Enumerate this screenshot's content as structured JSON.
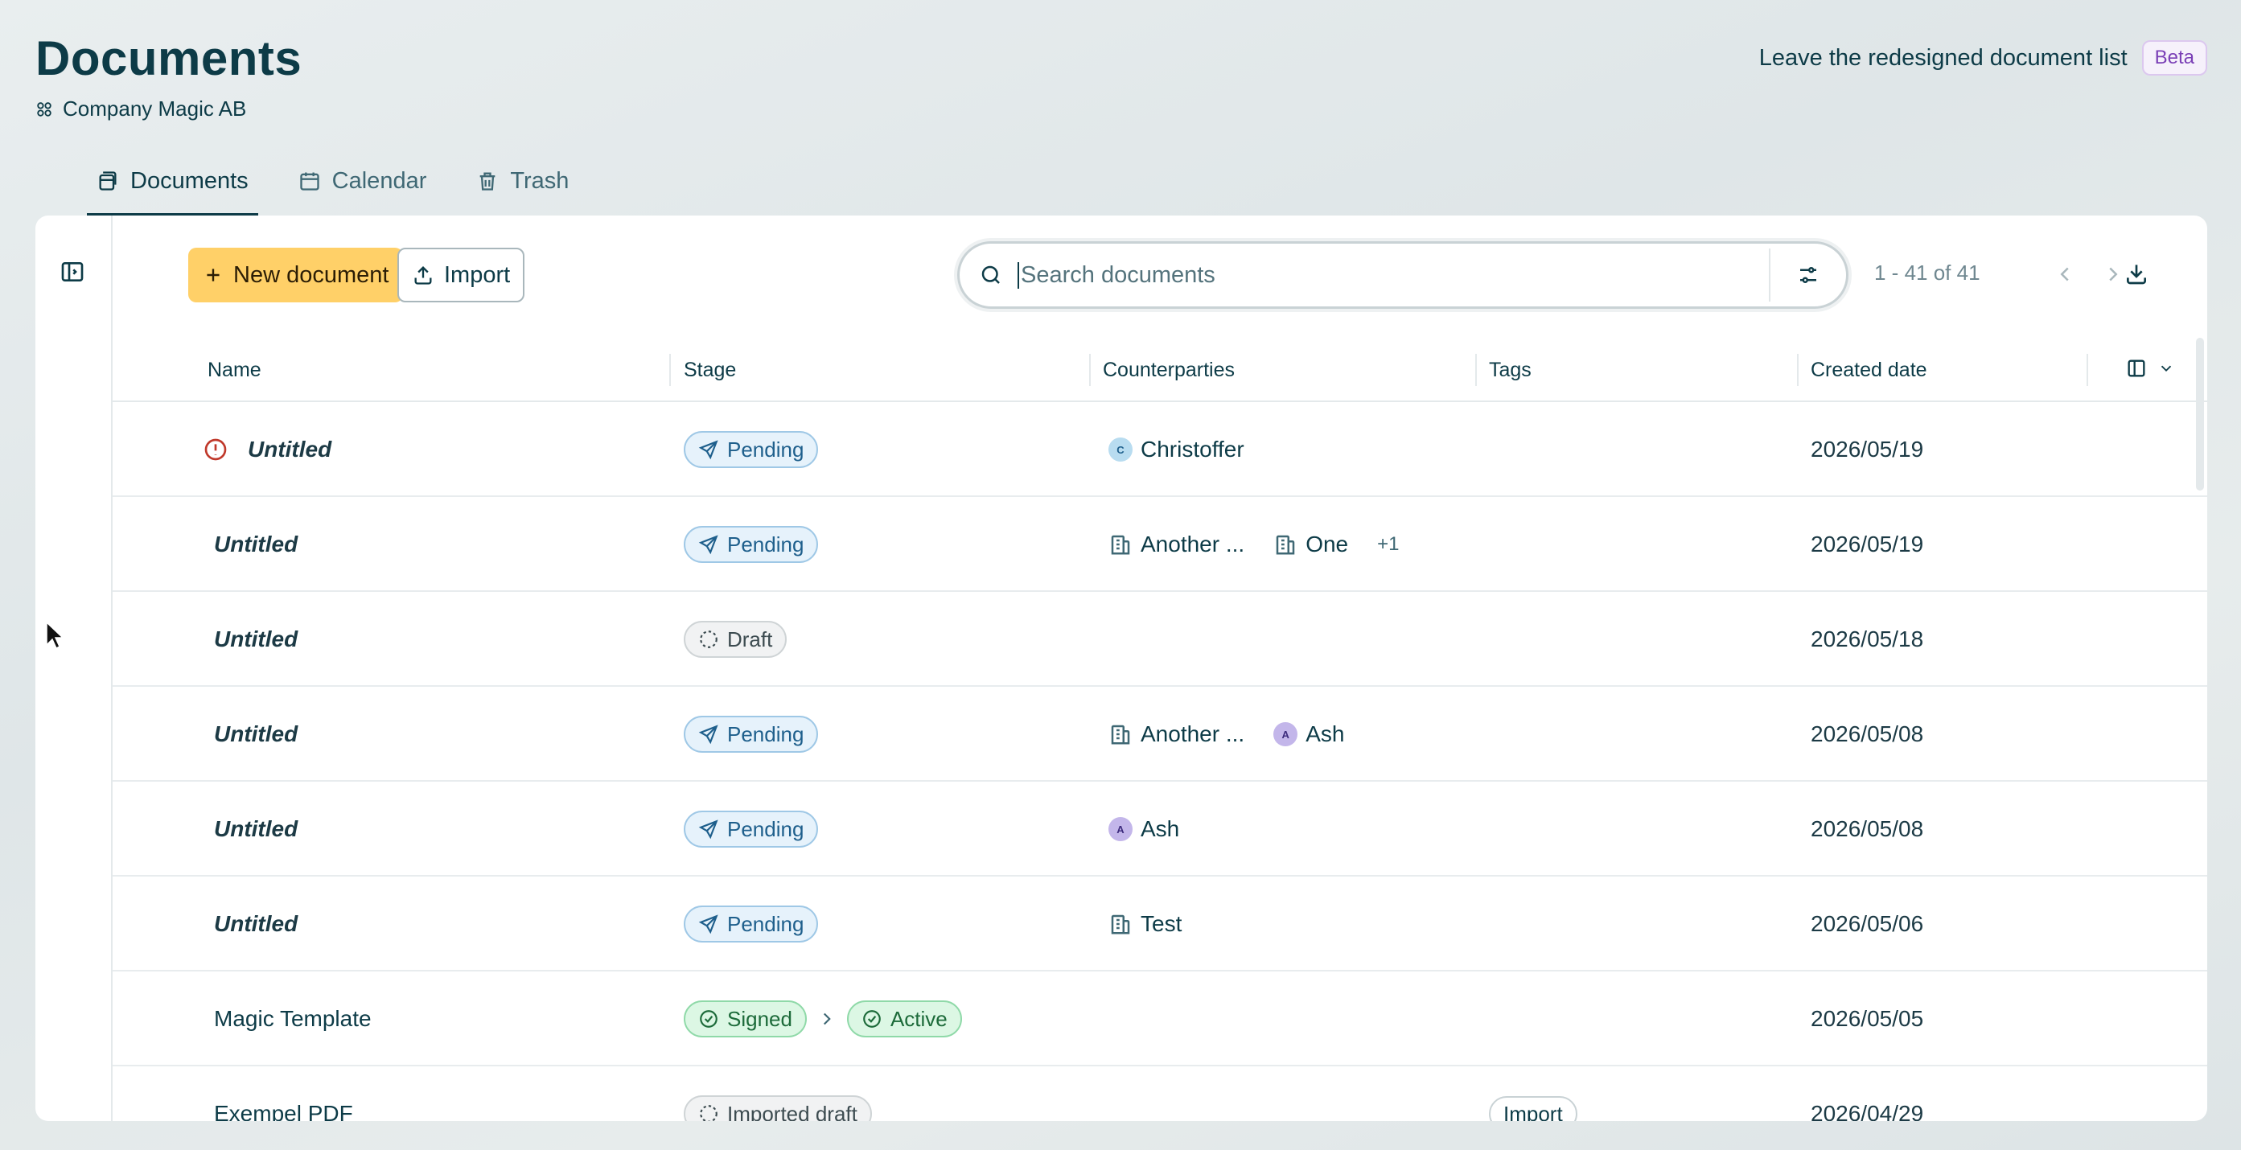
{
  "header": {
    "title": "Documents",
    "company": "Company Magic AB",
    "leave_link": "Leave the redesigned document list",
    "beta_badge": "Beta"
  },
  "tabs": [
    {
      "label": "Documents",
      "icon": "document-stack-icon",
      "active": true
    },
    {
      "label": "Calendar",
      "icon": "calendar-icon",
      "active": false
    },
    {
      "label": "Trash",
      "icon": "trash-icon",
      "active": false
    }
  ],
  "toolbar": {
    "new_document_label": "New document",
    "import_label": "Import",
    "search_placeholder": "Search documents",
    "pagination": "1 - 41 of 41"
  },
  "columns": [
    "Name",
    "Stage",
    "Counterparties",
    "Tags",
    "Created date"
  ],
  "rows": [
    {
      "name": "Untitled",
      "error": true,
      "stage": "Pending",
      "counterparties": [
        {
          "type": "person",
          "initial": "C",
          "name": "Christoffer"
        }
      ],
      "more": "",
      "tag": "",
      "date": "2026/05/19"
    },
    {
      "name": "Untitled",
      "stage": "Pending",
      "counterparties": [
        {
          "type": "company",
          "name": "Another ..."
        },
        {
          "type": "company",
          "name": "One"
        }
      ],
      "more": "+1",
      "tag": "",
      "date": "2026/05/19"
    },
    {
      "name": "Untitled",
      "stage": "Draft",
      "counterparties": [],
      "more": "",
      "tag": "",
      "date": "2026/05/18"
    },
    {
      "name": "Untitled",
      "stage": "Pending",
      "counterparties": [
        {
          "type": "company",
          "name": "Another ..."
        },
        {
          "type": "person",
          "initial": "A",
          "name": "Ash"
        }
      ],
      "more": "",
      "tag": "",
      "date": "2026/05/08"
    },
    {
      "name": "Untitled",
      "stage": "Pending",
      "counterparties": [
        {
          "type": "person",
          "initial": "A",
          "name": "Ash"
        }
      ],
      "more": "",
      "tag": "",
      "date": "2026/05/08"
    },
    {
      "name": "Untitled",
      "stage": "Pending",
      "counterparties": [
        {
          "type": "company",
          "name": "Test"
        }
      ],
      "more": "",
      "tag": "",
      "date": "2026/05/06"
    },
    {
      "name": "Magic Template",
      "stage": "Signed",
      "stage2": "Active",
      "counterparties": [],
      "more": "",
      "tag": "",
      "date": "2026/05/05"
    },
    {
      "name": "Exempel PDF",
      "stage": "Imported draft",
      "counterparties": [],
      "more": "",
      "tag": "Import",
      "date": "2026/04/29"
    }
  ],
  "colors": {
    "accent": "#ffd068",
    "ink": "#0d3b47",
    "pending": "#1e5f8c",
    "signed": "#1d6b3a"
  }
}
